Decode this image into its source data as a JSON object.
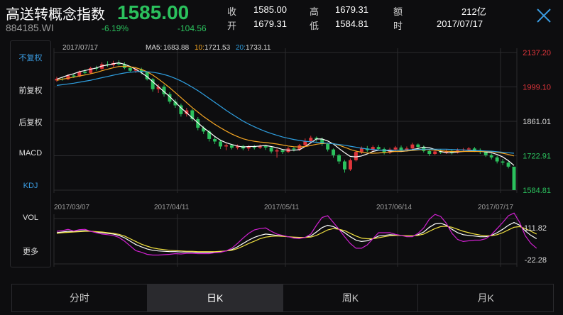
{
  "header": {
    "title": "高送转概念指数",
    "code": "884185.WI",
    "price": "1585.00",
    "change_pct": "-6.19%",
    "change": "-104.56",
    "quotes": [
      {
        "label": "收",
        "value": "1585.00"
      },
      {
        "label": "高",
        "value": "1679.31"
      },
      {
        "label": "额",
        "value": "212亿"
      },
      {
        "label": "开",
        "value": "1679.31"
      },
      {
        "label": "低",
        "value": "1584.81"
      },
      {
        "label": "时",
        "value": "2017/07/17"
      }
    ]
  },
  "sidebar": {
    "items": [
      {
        "label": "不复权",
        "active": true
      },
      {
        "label": "前复权",
        "active": false
      },
      {
        "label": "后复权",
        "active": false
      },
      {
        "label": "MACD",
        "active": false
      },
      {
        "label": "KDJ",
        "active": true
      },
      {
        "label": "VOL",
        "active": false
      },
      {
        "label": "更多",
        "active": false
      }
    ]
  },
  "legend": {
    "date": "2017/07/17",
    "ma5_label": "MA5:",
    "ma5_value": "1683.88",
    "ma10_label": "10:",
    "ma10_value": "1721.53",
    "ma20_label": "20:",
    "ma20_value": "1733.11"
  },
  "tabs": [
    {
      "label": "分时",
      "active": false
    },
    {
      "label": "日K",
      "active": true
    },
    {
      "label": "周K",
      "active": false
    },
    {
      "label": "月K",
      "active": false
    }
  ],
  "colors": {
    "up": "#e0353b",
    "down": "#2bc15d",
    "accent": "#3a9be0",
    "ma5": "#ffffff",
    "ma10": "#f5a623",
    "ma20": "#2f9fe0",
    "k": "#ffffff",
    "d": "#f0e040",
    "j": "#d020d0"
  },
  "chart_data": [
    {
      "type": "candlestick",
      "title": "",
      "x_ticks": [
        "2017/03/07",
        "2017/04/11",
        "2017/05/11",
        "2017/06/14",
        "2017/07/17"
      ],
      "y_ticks": [
        "2137.20",
        "1999.10",
        "1861.01",
        "1722.91",
        "1584.81"
      ],
      "ylim": [
        1584.81,
        2137.2
      ],
      "grid": true,
      "series": [
        {
          "name": "MA5",
          "values": [
            2030,
            2038,
            2046,
            2052,
            2060,
            2065,
            2070,
            2075,
            2083,
            2087,
            2092,
            2096,
            2090,
            2081,
            2070,
            2056,
            2040,
            2020,
            2000,
            1980,
            1960,
            1938,
            1915,
            1895,
            1875,
            1855,
            1835,
            1818,
            1800,
            1785,
            1775,
            1768,
            1762,
            1758,
            1760,
            1760,
            1762,
            1764,
            1760,
            1755,
            1748,
            1745,
            1745,
            1747,
            1760,
            1775,
            1790,
            1790,
            1782,
            1770,
            1752,
            1735,
            1720,
            1718,
            1722,
            1730,
            1740,
            1745,
            1745,
            1742,
            1740,
            1740,
            1742,
            1748,
            1752,
            1758,
            1755,
            1748,
            1740,
            1735,
            1735,
            1738,
            1740,
            1741,
            1742,
            1741,
            1738,
            1735,
            1728,
            1718,
            1703,
            1684
          ]
        },
        {
          "name": "MA10",
          "values": [
            2025,
            2030,
            2034,
            2038,
            2043,
            2047,
            2052,
            2057,
            2064,
            2070,
            2076,
            2081,
            2082,
            2080,
            2076,
            2069,
            2060,
            2047,
            2031,
            2014,
            1996,
            1976,
            1956,
            1936,
            1916,
            1898,
            1880,
            1864,
            1849,
            1835,
            1822,
            1810,
            1800,
            1791,
            1785,
            1781,
            1778,
            1776,
            1773,
            1770,
            1766,
            1762,
            1759,
            1758,
            1760,
            1764,
            1769,
            1772,
            1773,
            1772,
            1765,
            1757,
            1748,
            1741,
            1737,
            1734,
            1733,
            1734,
            1736,
            1738,
            1740,
            1741,
            1742,
            1744,
            1746,
            1748,
            1747,
            1745,
            1743,
            1741,
            1740,
            1740,
            1740,
            1740,
            1740,
            1740,
            1740,
            1739,
            1737,
            1733,
            1728,
            1722
          ]
        },
        {
          "name": "MA20",
          "values": [
            2005,
            2008,
            2011,
            2014,
            2018,
            2022,
            2026,
            2031,
            2036,
            2041,
            2046,
            2051,
            2055,
            2058,
            2060,
            2061,
            2060,
            2058,
            2054,
            2049,
            2042,
            2033,
            2023,
            2011,
            1998,
            1984,
            1969,
            1953,
            1937,
            1921,
            1905,
            1890,
            1876,
            1862,
            1850,
            1839,
            1829,
            1820,
            1812,
            1805,
            1798,
            1793,
            1788,
            1784,
            1781,
            1779,
            1777,
            1775,
            1773,
            1771,
            1768,
            1765,
            1761,
            1757,
            1753,
            1750,
            1748,
            1746,
            1745,
            1745,
            1745,
            1745,
            1746,
            1747,
            1748,
            1749,
            1749,
            1749,
            1749,
            1749,
            1748,
            1747,
            1746,
            1745,
            1744,
            1743,
            1742,
            1741,
            1739,
            1737,
            1735,
            1733
          ]
        }
      ],
      "candles": [
        [
          2025,
          2032,
          2040,
          2020
        ],
        [
          2032,
          2030,
          2038,
          2024
        ],
        [
          2030,
          2045,
          2050,
          2026
        ],
        [
          2045,
          2041,
          2052,
          2035
        ],
        [
          2041,
          2060,
          2065,
          2038
        ],
        [
          2060,
          2055,
          2070,
          2050
        ],
        [
          2055,
          2075,
          2080,
          2050
        ],
        [
          2075,
          2072,
          2084,
          2064
        ],
        [
          2072,
          2090,
          2098,
          2068
        ],
        [
          2090,
          2086,
          2102,
          2080
        ],
        [
          2086,
          2095,
          2104,
          2080
        ],
        [
          2095,
          2090,
          2106,
          2085
        ],
        [
          2090,
          2075,
          2098,
          2070
        ],
        [
          2075,
          2064,
          2082,
          2058
        ],
        [
          2064,
          2070,
          2078,
          2055
        ],
        [
          2070,
          2058,
          2076,
          2050
        ],
        [
          2058,
          2030,
          2062,
          2025
        ],
        [
          2030,
          1990,
          2035,
          1980
        ],
        [
          1990,
          2000,
          2010,
          1975
        ],
        [
          2000,
          1970,
          2008,
          1960
        ],
        [
          1970,
          1940,
          1978,
          1932
        ],
        [
          1940,
          1925,
          1950,
          1915
        ],
        [
          1925,
          1890,
          1932,
          1880
        ],
        [
          1890,
          1905,
          1915,
          1880
        ],
        [
          1905,
          1870,
          1910,
          1862
        ],
        [
          1870,
          1835,
          1878,
          1825
        ],
        [
          1835,
          1820,
          1842,
          1810
        ],
        [
          1820,
          1790,
          1826,
          1780
        ],
        [
          1790,
          1780,
          1800,
          1770
        ],
        [
          1780,
          1760,
          1788,
          1750
        ],
        [
          1760,
          1765,
          1772,
          1745
        ],
        [
          1765,
          1755,
          1770,
          1748
        ],
        [
          1755,
          1762,
          1768,
          1748
        ],
        [
          1762,
          1752,
          1766,
          1745
        ],
        [
          1752,
          1760,
          1765,
          1742
        ],
        [
          1760,
          1755,
          1766,
          1748
        ],
        [
          1755,
          1762,
          1768,
          1750
        ],
        [
          1762,
          1756,
          1766,
          1746
        ],
        [
          1756,
          1740,
          1760,
          1732
        ],
        [
          1740,
          1745,
          1752,
          1715
        ],
        [
          1745,
          1738,
          1750,
          1730
        ],
        [
          1738,
          1752,
          1758,
          1734
        ],
        [
          1752,
          1748,
          1760,
          1740
        ],
        [
          1748,
          1765,
          1770,
          1742
        ],
        [
          1765,
          1780,
          1792,
          1760
        ],
        [
          1780,
          1795,
          1803,
          1772
        ],
        [
          1795,
          1790,
          1800,
          1780
        ],
        [
          1790,
          1770,
          1796,
          1762
        ],
        [
          1770,
          1748,
          1776,
          1740
        ],
        [
          1748,
          1725,
          1752,
          1715
        ],
        [
          1725,
          1700,
          1730,
          1690
        ],
        [
          1700,
          1668,
          1706,
          1655
        ],
        [
          1668,
          1705,
          1712,
          1662
        ],
        [
          1705,
          1738,
          1745,
          1700
        ],
        [
          1738,
          1752,
          1760,
          1730
        ],
        [
          1752,
          1745,
          1762,
          1738
        ],
        [
          1745,
          1758,
          1764,
          1742
        ],
        [
          1758,
          1750,
          1766,
          1744
        ],
        [
          1750,
          1735,
          1756,
          1728
        ],
        [
          1735,
          1748,
          1755,
          1730
        ],
        [
          1748,
          1756,
          1762,
          1742
        ],
        [
          1756,
          1745,
          1764,
          1738
        ],
        [
          1745,
          1752,
          1760,
          1740
        ],
        [
          1752,
          1768,
          1775,
          1748
        ],
        [
          1768,
          1758,
          1772,
          1750
        ],
        [
          1758,
          1742,
          1764,
          1736
        ],
        [
          1742,
          1730,
          1748,
          1722
        ],
        [
          1730,
          1740,
          1746,
          1726
        ],
        [
          1740,
          1736,
          1748,
          1730
        ],
        [
          1736,
          1742,
          1750,
          1730
        ],
        [
          1742,
          1735,
          1748,
          1728
        ],
        [
          1735,
          1744,
          1752,
          1732
        ],
        [
          1744,
          1748,
          1754,
          1740
        ],
        [
          1748,
          1752,
          1758,
          1742
        ],
        [
          1752,
          1745,
          1758,
          1738
        ],
        [
          1745,
          1738,
          1752,
          1730
        ],
        [
          1738,
          1725,
          1742,
          1718
        ],
        [
          1725,
          1716,
          1732,
          1708
        ],
        [
          1716,
          1700,
          1722,
          1692
        ],
        [
          1700,
          1695,
          1710,
          1685
        ],
        [
          1695,
          1679,
          1700,
          1672
        ],
        [
          1679,
          1585,
          1679,
          1585
        ]
      ]
    },
    {
      "type": "line",
      "title": "KDJ",
      "y_ticks": [
        "111.82",
        "-22.28"
      ],
      "ylim": [
        -22.28,
        111.82
      ],
      "series": [
        {
          "name": "K",
          "values": [
            70,
            72,
            74,
            73,
            75,
            76,
            74,
            72,
            70,
            68,
            66,
            62,
            55,
            45,
            35,
            28,
            22,
            18,
            16,
            15,
            14,
            14,
            13,
            13,
            13,
            12,
            12,
            12,
            13,
            14,
            16,
            20,
            28,
            38,
            48,
            56,
            62,
            66,
            64,
            62,
            60,
            58,
            56,
            55,
            56,
            60,
            72,
            85,
            92,
            88,
            80,
            70,
            58,
            48,
            44,
            46,
            52,
            60,
            62,
            64,
            63,
            62,
            60,
            60,
            64,
            72,
            86,
            96,
            98,
            92,
            80,
            70,
            64,
            62,
            60,
            58,
            58,
            62,
            70,
            80,
            92,
            100,
            92,
            75,
            62,
            52
          ]
        },
        {
          "name": "D",
          "values": [
            68,
            70,
            71,
            72,
            73,
            74,
            74,
            73,
            72,
            70,
            68,
            65,
            60,
            52,
            44,
            36,
            30,
            25,
            22,
            20,
            18,
            17,
            16,
            15,
            15,
            14,
            14,
            14,
            14,
            15,
            16,
            18,
            23,
            30,
            38,
            45,
            52,
            57,
            59,
            60,
            59,
            58,
            57,
            56,
            56,
            57,
            62,
            70,
            78,
            82,
            80,
            76,
            68,
            60,
            54,
            52,
            52,
            55,
            58,
            61,
            62,
            62,
            61,
            61,
            62,
            66,
            74,
            82,
            88,
            89,
            86,
            80,
            74,
            70,
            66,
            63,
            61,
            61,
            64,
            70,
            78,
            86,
            88,
            82,
            74,
            66
          ]
        },
        {
          "name": "J",
          "values": [
            74,
            76,
            80,
            75,
            79,
            80,
            74,
            70,
            66,
            64,
            62,
            56,
            45,
            31,
            17,
            12,
            6,
            4,
            4,
            5,
            6,
            8,
            7,
            9,
            9,
            8,
            8,
            8,
            11,
            12,
            16,
            24,
            38,
            54,
            68,
            78,
            82,
            84,
            74,
            66,
            62,
            58,
            54,
            53,
            56,
            66,
            92,
            115,
            120,
            100,
            80,
            58,
            38,
            24,
            24,
            34,
            52,
            70,
            70,
            70,
            65,
            62,
            58,
            58,
            68,
            84,
            110,
            124,
            118,
            98,
            68,
            50,
            44,
            46,
            48,
            48,
            52,
            64,
            82,
            100,
            120,
            128,
            100,
            61,
            38,
            24
          ]
        }
      ]
    }
  ]
}
